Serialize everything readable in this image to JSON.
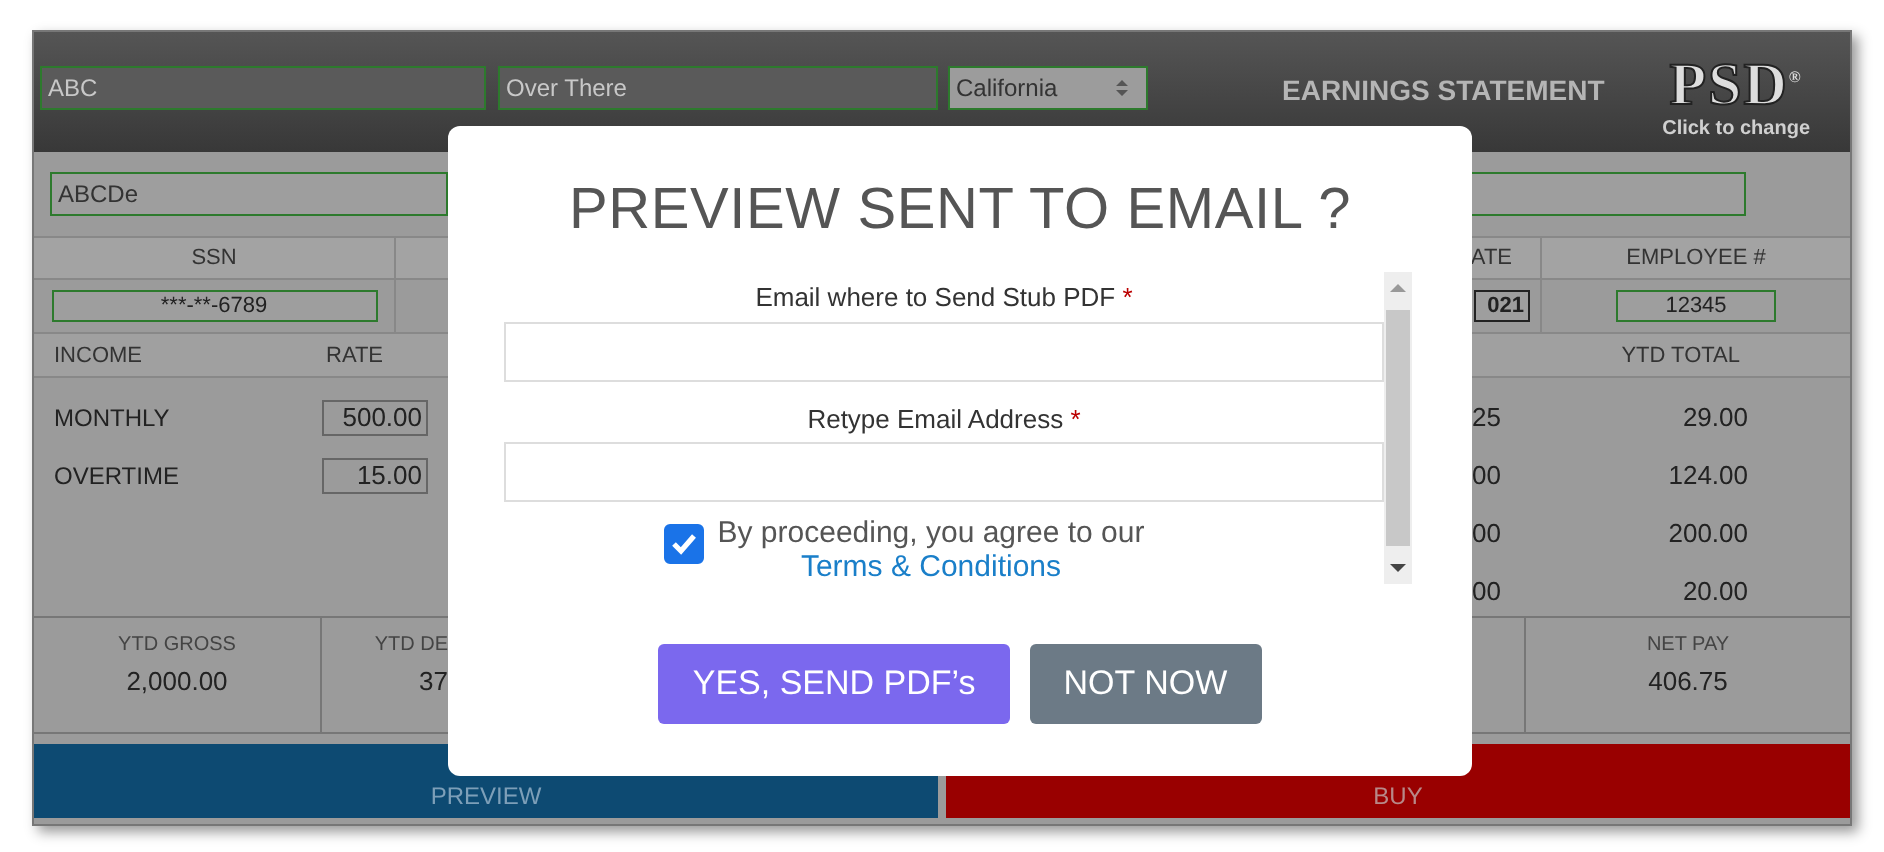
{
  "header": {
    "fields": [
      {
        "value": "ABC"
      },
      {
        "value": "Over There"
      }
    ],
    "state_select": {
      "value": "California"
    },
    "title": "EARNINGS STATEMENT",
    "logo": {
      "text": "PSD$^{®}$",
      "caption": "Click to change"
    }
  },
  "name_row": {
    "value": "ABCDe"
  },
  "info": [
    {
      "header": "SSN",
      "value": "***-**-6789"
    },
    {
      "header": "ATE",
      "value": "021"
    },
    {
      "header": "EMPLOYEE #",
      "value": "12345"
    }
  ],
  "income": {
    "headers": [
      "INCOME",
      "RATE",
      "YTD TOTAL"
    ],
    "rows": [
      {
        "label": "MONTHLY",
        "rate": "500.00",
        "column_3": "25",
        "ytd": "29.00"
      },
      {
        "label": "OVERTIME",
        "rate": "15.00",
        "column_3": "00",
        "ytd": "124.00"
      },
      {
        "column_3": "00",
        "ytd": "200.00"
      },
      {
        "column_3": "00",
        "ytd": "20.00"
      }
    ]
  },
  "summary": [
    {
      "label": "YTD GROSS",
      "value": "2,000.00"
    },
    {
      "label": "YTD DE",
      "value": "37"
    },
    {
      "label": "NET PAY",
      "value": "406.75"
    }
  ],
  "actions": [
    {
      "label": "PREVIEW",
      "kind": "preview"
    },
    {
      "label": "BUY",
      "kind": "buy"
    }
  ],
  "modal": {
    "title": "PREVIEW SENT TO EMAIL ?",
    "fields": [
      {
        "label": "Email where to Send Stub PDF",
        "mark": "*"
      },
      {
        "label": "Retype Email Address",
        "mark": "*"
      }
    ],
    "consent": {
      "text": "By proceeding, you agree to our",
      "link": "Terms & Conditions",
      "checked": true
    },
    "buttons": [
      {
        "label": "YES, SEND PDF’s",
        "kind": "primary"
      },
      {
        "label": "NOT NOW",
        "kind": "secondary"
      }
    ]
  }
}
